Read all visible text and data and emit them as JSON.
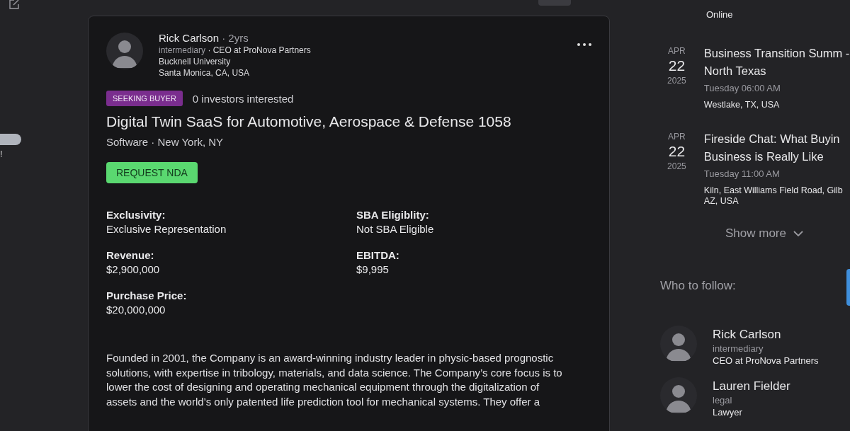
{
  "left_panel": {
    "mark": "!"
  },
  "post": {
    "author": {
      "name": "Rick Carlson",
      "age": "· 2yrs",
      "role": "intermediary",
      "title": "· CEO at ProNova Partners",
      "school": "Bucknell University",
      "location": "Santa Monica, CA, USA"
    },
    "tag": "SEEKING BUYER",
    "interest": "0 investors interested",
    "title": "Digital Twin SaaS for Automotive, Aerospace & Defense 1058",
    "subtitle": "Software · New York, NY",
    "cta": "REQUEST NDA",
    "fields": [
      {
        "label": "Exclusivity:",
        "value": "Exclusive Representation"
      },
      {
        "label": "SBA Eligiblity:",
        "value": "Not SBA Eligible"
      },
      {
        "label": "Revenue:",
        "value": "$2,900,000"
      },
      {
        "label": "EBITDA:",
        "value": "$9,995"
      },
      {
        "label": "Purchase Price:",
        "value": "$20,000,000"
      }
    ],
    "description": "Founded in 2001, the Company is an award-winning industry leader in physic-based prognostic solutions, with expertise in tribology, materials, and data science. The Company’s core focus is to lower the cost of designing and operating mechanical equipment through the digitalization of assets and the world’s only patented life prediction tool for mechanical systems. They offer a"
  },
  "events": {
    "previous_location": "Online",
    "items": [
      {
        "month": "APR",
        "day": "22",
        "year": "2025",
        "title": "Business Transition Summ - North Texas",
        "time": "Tuesday 06:00 AM",
        "location": "Westlake, TX, USA"
      },
      {
        "month": "APR",
        "day": "22",
        "year": "2025",
        "title": "Fireside Chat: What Buyin Business is Really Like",
        "time": "Tuesday 11:00 AM",
        "location": "Kiln, East Williams Field Road, Gilb AZ, USA"
      }
    ],
    "show_more": "Show more"
  },
  "who_to_follow": {
    "heading": "Who to follow:",
    "people": [
      {
        "name": "Rick Carlson",
        "role": "intermediary",
        "title": "CEO at ProNova Partners"
      },
      {
        "name": "Lauren Fielder",
        "role": "legal",
        "title": "Lawyer"
      }
    ]
  }
}
